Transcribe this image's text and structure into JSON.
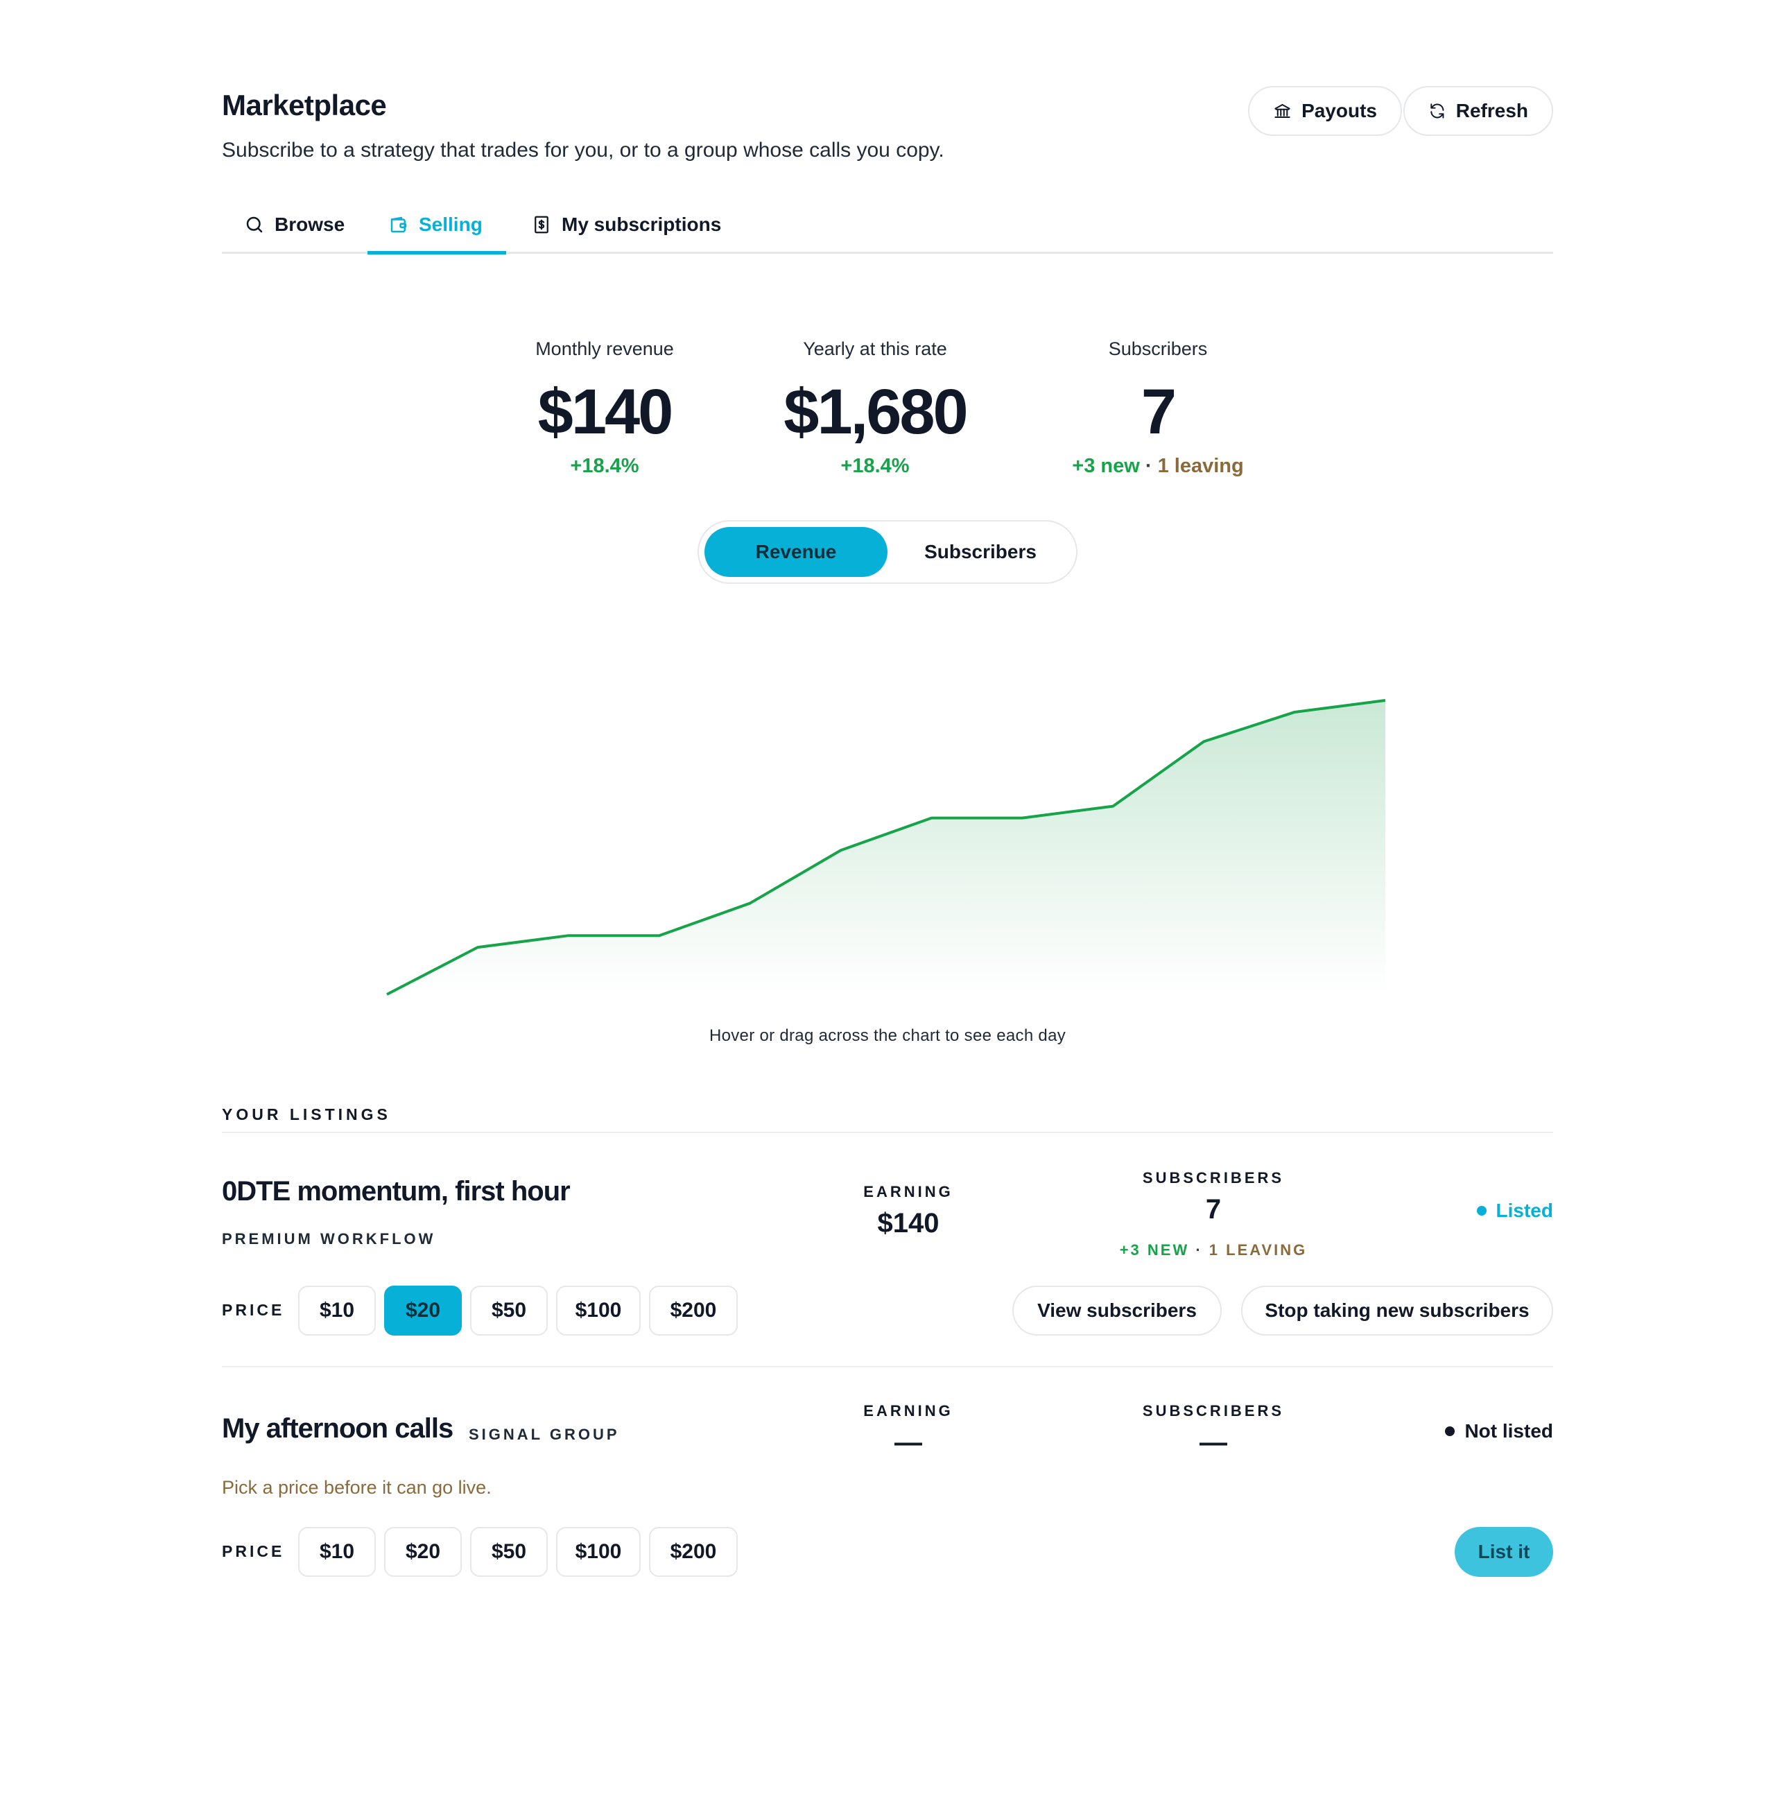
{
  "header": {
    "title": "Marketplace",
    "subtitle": "Subscribe to a strategy that trades for you, or to a group whose calls you copy.",
    "payouts_label": "Payouts",
    "refresh_label": "Refresh"
  },
  "tabs": [
    {
      "label": "Browse",
      "icon": "search-icon",
      "active": false
    },
    {
      "label": "Selling",
      "icon": "wallet-icon",
      "active": true
    },
    {
      "label": "My subscriptions",
      "icon": "receipt-icon",
      "active": false
    }
  ],
  "stats": {
    "monthly": {
      "label": "Monthly revenue",
      "value": "$140",
      "delta": "+18.4%"
    },
    "yearly": {
      "label": "Yearly at this rate",
      "value": "$1,680",
      "delta": "+18.4%"
    },
    "subscribers": {
      "label": "Subscribers",
      "value": "7",
      "new": "+3 new",
      "sep": "·",
      "leaving": "1 leaving"
    }
  },
  "toggle": {
    "revenue": "Revenue",
    "subscribers": "Subscribers",
    "selected": "Revenue"
  },
  "chart_hint": "Hover or drag across the chart to see each day",
  "chart_data": {
    "type": "area",
    "title": "",
    "xlabel": "",
    "ylabel": "",
    "x": [
      1,
      2,
      3,
      4,
      5,
      6,
      7,
      8,
      9,
      10,
      11,
      12
    ],
    "values": [
      0,
      16,
      20,
      20,
      31,
      49,
      60,
      60,
      64,
      86,
      96,
      100
    ],
    "ylim": [
      0,
      100
    ],
    "grid": false,
    "colors": {
      "line": "#16a34a",
      "fill": "#22a152"
    }
  },
  "listings": {
    "section_label": "YOUR LISTINGS",
    "earning_label": "EARNING",
    "subscribers_label": "SUBSCRIBERS",
    "price_label": "PRICE",
    "price_options": [
      "$10",
      "$20",
      "$50",
      "$100",
      "$200"
    ],
    "items": [
      {
        "name": "0DTE momentum, first hour",
        "kind": "PREMIUM WORKFLOW",
        "earning": "$140",
        "subscribers": "7",
        "sub_new": "+3 NEW",
        "sub_sep": "·",
        "sub_leaving": "1 LEAVING",
        "status": "Listed",
        "status_color": "#06b0d6",
        "selected_price": "$20",
        "view_label": "View subscribers",
        "stop_label": "Stop taking new subscribers"
      },
      {
        "name": "My afternoon calls",
        "kind": "SIGNAL GROUP",
        "earning": "—",
        "subscribers": "—",
        "status": "Not listed",
        "status_color": "#111827",
        "hint": "Pick a price before it can go live.",
        "list_label": "List it"
      }
    ]
  },
  "colors": {
    "accent": "#06b0d6",
    "positive": "#16a34a",
    "warning": "#8a6a3a"
  }
}
